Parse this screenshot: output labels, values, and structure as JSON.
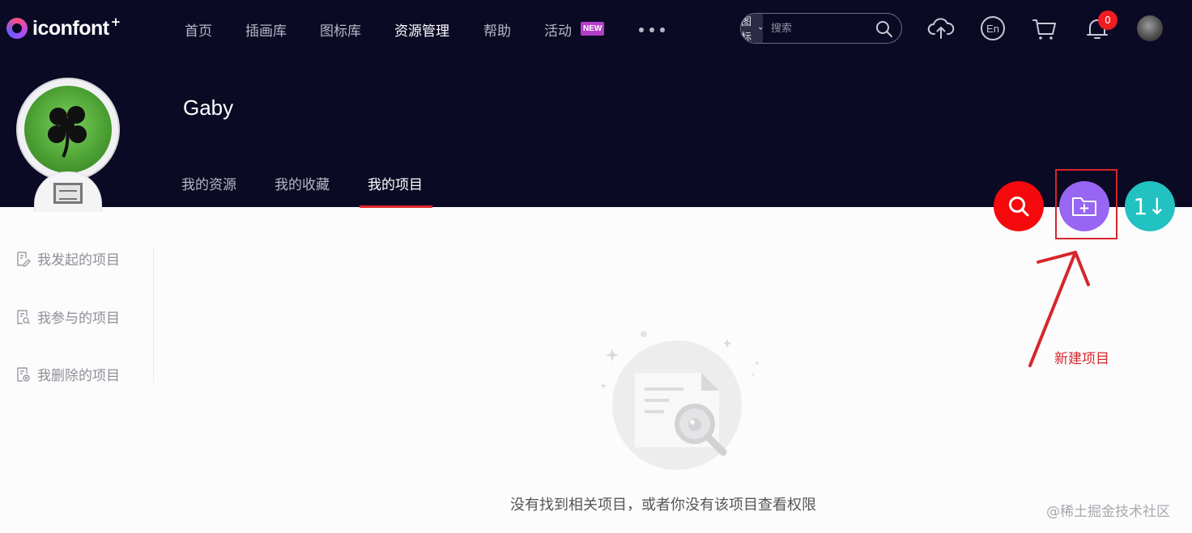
{
  "logo": {
    "text": "iconfont",
    "plus": "+"
  },
  "nav": {
    "items": [
      "首页",
      "插画库",
      "图标库",
      "资源管理",
      "帮助",
      "活动"
    ],
    "active": "资源管理",
    "new_badge": "NEW"
  },
  "search": {
    "type_label": "图标",
    "placeholder": "搜索"
  },
  "notifications": {
    "count": "0"
  },
  "profile": {
    "name": "Gaby",
    "tabs": [
      "我的资源",
      "我的收藏",
      "我的项目"
    ],
    "active_tab": "我的项目"
  },
  "sidebar": {
    "items": [
      "我发起的项目",
      "我参与的项目",
      "我删除的项目"
    ]
  },
  "fab": {
    "sort_label": "1↓"
  },
  "annotation": {
    "label": "新建项目"
  },
  "empty_state": {
    "message": "没有找到相关项目，或者你没有该项目查看权限"
  },
  "watermark": {
    "text": "@稀土掘金技术社区"
  },
  "colors": {
    "nav_bg": "#0b0a24",
    "accent_red": "#f5090d",
    "accent_purple": "#9766f3",
    "accent_teal": "#22c1c2",
    "annotation_red": "#d6262c"
  }
}
